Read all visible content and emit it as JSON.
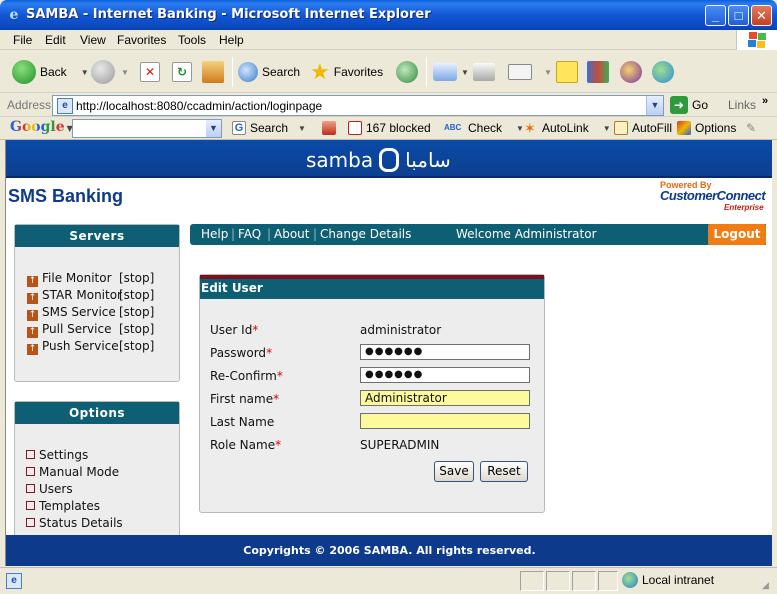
{
  "window": {
    "title": "SAMBA - Internet Banking - Microsoft Internet Explorer",
    "min": "_",
    "max": "□",
    "close": "✕"
  },
  "menu": [
    "File",
    "Edit",
    "View",
    "Favorites",
    "Tools",
    "Help"
  ],
  "toolbar": {
    "back": "Back",
    "search": "Search",
    "favorites": "Favorites"
  },
  "address": {
    "label": "Address",
    "url": "http://localhost:8080/ccadmin/action/loginpage",
    "go": "Go",
    "links": "Links"
  },
  "google": {
    "logo": "Google",
    "search": "Search",
    "blocked": "167 blocked",
    "check": "Check",
    "autolink": "AutoLink",
    "autofill": "AutoFill",
    "options": "Options"
  },
  "page": {
    "brand_en": "samba",
    "brand_ar": "سامبا",
    "heading": "SMS Banking",
    "powered_by": "Powered By",
    "cc": "CustomerConnect",
    "enterprise": "Enterprise",
    "servers": {
      "title": "Servers",
      "items": [
        {
          "name": "File Monitor",
          "action": "[stop]"
        },
        {
          "name": "STAR Monitor",
          "action": "[stop]"
        },
        {
          "name": "SMS Service",
          "action": "[stop]"
        },
        {
          "name": "Pull Service",
          "action": "[stop]"
        },
        {
          "name": "Push Service",
          "action": "[stop]"
        }
      ]
    },
    "options": {
      "title": "Options",
      "items": [
        "Settings",
        "Manual Mode",
        "Users",
        "Templates",
        "Status Details"
      ]
    },
    "nav": {
      "help": "Help",
      "faq": "FAQ",
      "about": "About",
      "change": "Change Details",
      "welcome": "Welcome Administrator",
      "logout": "Logout"
    },
    "form": {
      "title": "Edit User",
      "user_id_label": "User Id",
      "user_id": "administrator",
      "password_label": "Password",
      "password": "●●●●●●",
      "reconfirm_label": "Re-Confirm",
      "reconfirm": "●●●●●●",
      "first_label": "First name",
      "first": "Administrator",
      "last_label": "Last Name",
      "last": "",
      "role_label": "Role Name",
      "role": "SUPERADMIN",
      "required_mark": "*",
      "save": "Save",
      "reset": "Reset"
    },
    "footer": "Copyrights © 2006 SAMBA. All rights reserved."
  },
  "status": {
    "zone": "Local intranet"
  }
}
